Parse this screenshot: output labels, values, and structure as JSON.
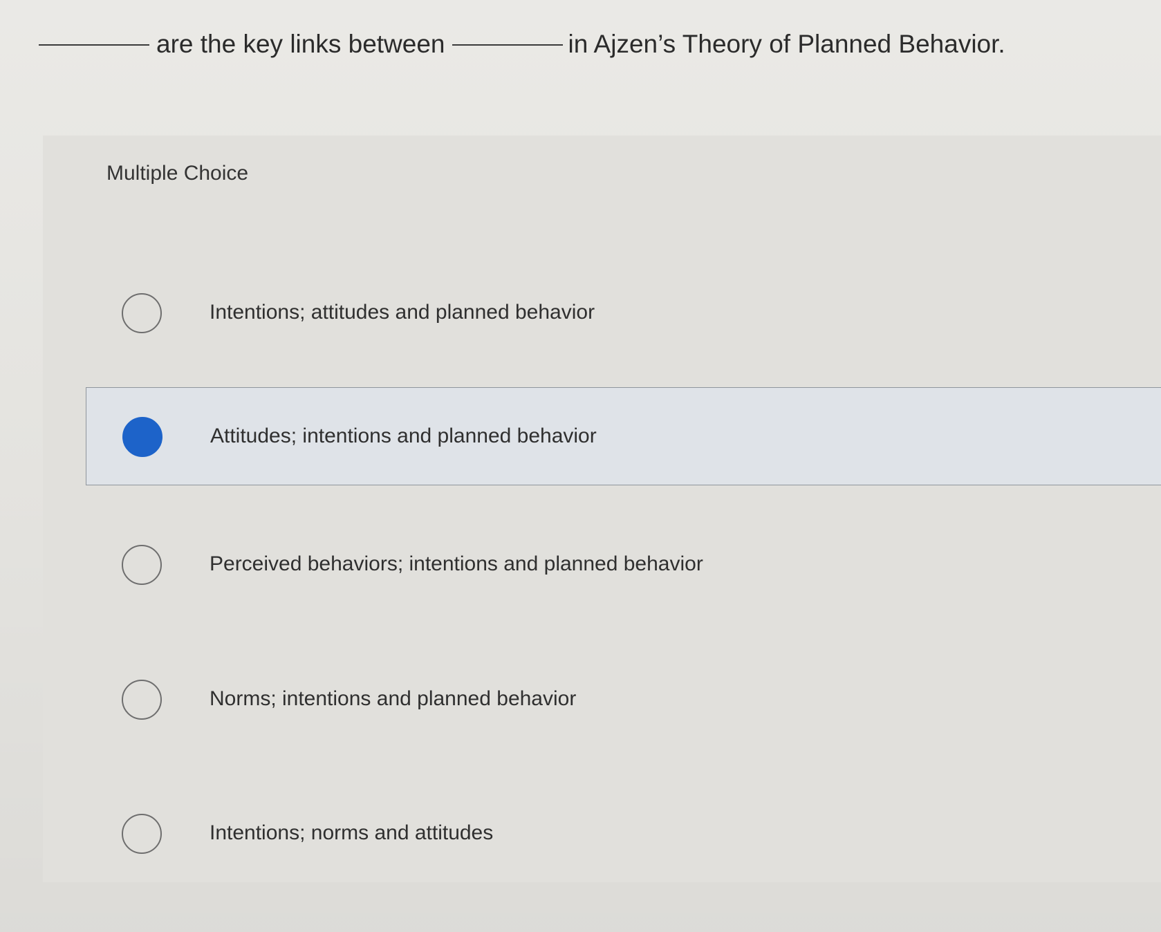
{
  "question": {
    "text_middle": "are the key links between",
    "text_end": "in Ajzen’s Theory of Planned Behavior."
  },
  "section_label": "Multiple Choice",
  "options": [
    {
      "label": "Intentions; attitudes and planned behavior",
      "selected": false
    },
    {
      "label": "Attitudes; intentions and planned behavior",
      "selected": true
    },
    {
      "label": "Perceived behaviors; intentions and planned behavior",
      "selected": false
    },
    {
      "label": "Norms; intentions and planned behavior",
      "selected": false
    },
    {
      "label": "Intentions; norms and attitudes",
      "selected": false
    }
  ],
  "colors": {
    "selected_radio": "#1d63c9",
    "selected_row_background": "#dfe3e8"
  }
}
